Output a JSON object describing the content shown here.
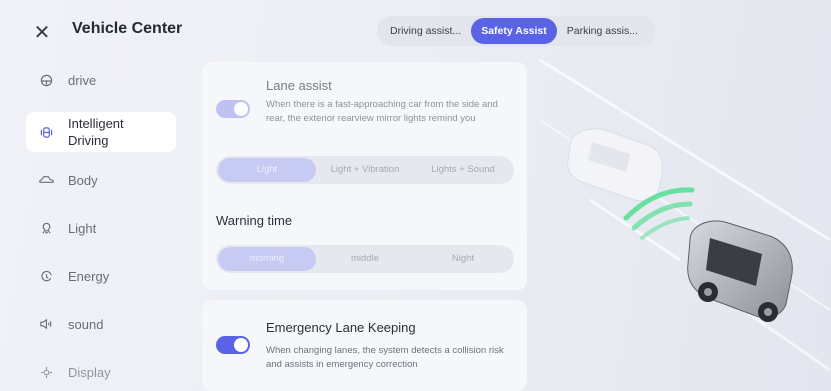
{
  "header": {
    "close_icon": "close-icon",
    "title": "Vehicle Center",
    "tabs": [
      {
        "label": "Driving assist...",
        "active": false
      },
      {
        "label": "Safety Assist",
        "active": true
      },
      {
        "label": "Parking assis...",
        "active": false
      }
    ]
  },
  "sidebar": {
    "items": [
      {
        "label": "drive",
        "icon": "steering-wheel-icon",
        "active": false
      },
      {
        "label": "Intelligent Driving",
        "icon": "car-sensor-icon",
        "active": true
      },
      {
        "label": "Body",
        "icon": "car-body-icon",
        "active": false
      },
      {
        "label": "Light",
        "icon": "light-bulb-icon",
        "active": false
      },
      {
        "label": "Energy",
        "icon": "energy-icon",
        "active": false
      },
      {
        "label": "sound",
        "icon": "speaker-icon",
        "active": false
      },
      {
        "label": "Display",
        "icon": "display-icon",
        "active": false
      }
    ]
  },
  "lane_assist": {
    "title": "Lane assist",
    "enabled": true,
    "description": "When there is a fast-approaching car from the side and rear, the exterior rearview mirror lights remind you",
    "alert_options": [
      "Light",
      "Light + Vibration",
      "Lights + Sound"
    ],
    "alert_selected": "Light"
  },
  "warning_time": {
    "label": "Warning time",
    "options": [
      "morning",
      "middle",
      "Night"
    ],
    "selected": "morning"
  },
  "emergency_lane_keeping": {
    "title": "Emergency Lane Keeping",
    "enabled": true,
    "description": "When changing lanes, the system detects a collision risk and assists in emergency correction"
  },
  "colors": {
    "accent": "#5a63e6",
    "accent_dim": "#c7caf3",
    "background": "#eceef4"
  }
}
